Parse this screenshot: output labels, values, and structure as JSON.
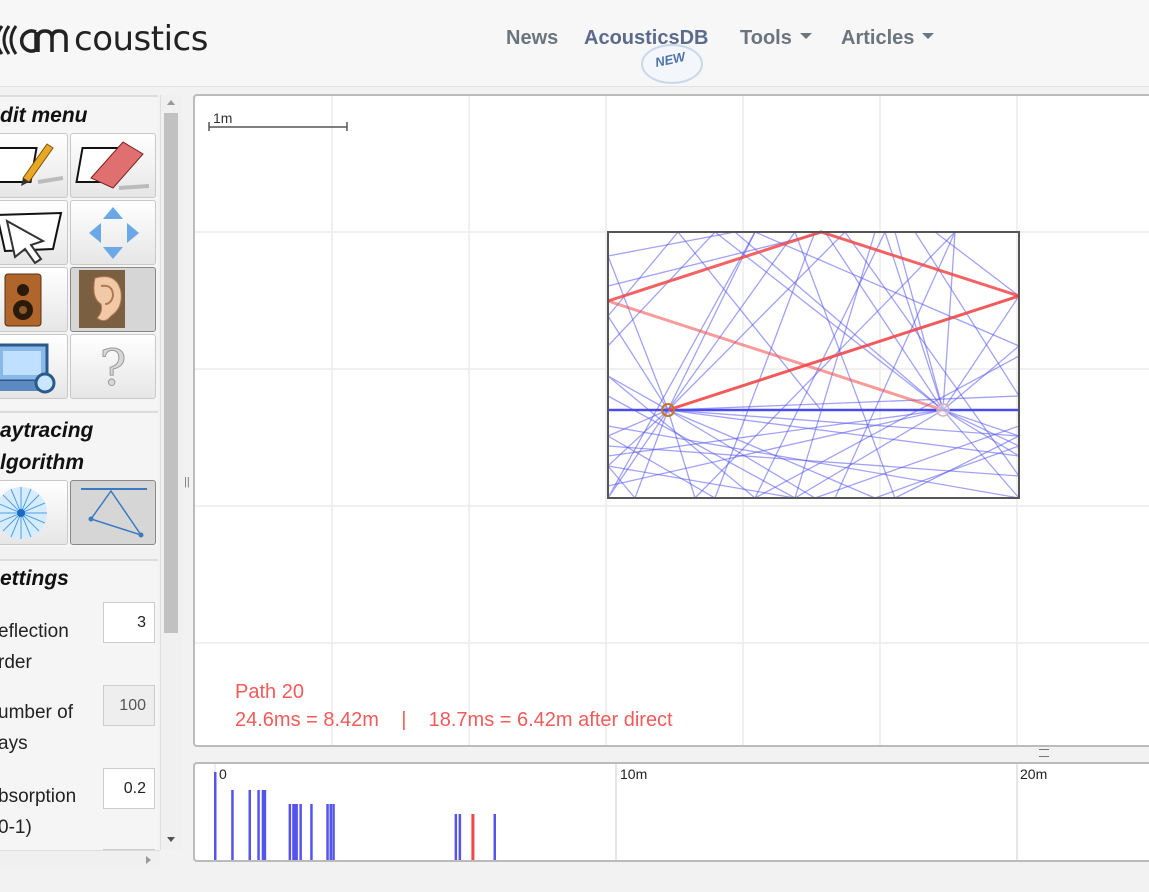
{
  "header": {
    "logo_text": "coustics",
    "nav": [
      {
        "label": "News"
      },
      {
        "label": "AcousticsDB",
        "badge": "NEW"
      },
      {
        "label": "Tools"
      },
      {
        "label": "Articles"
      }
    ]
  },
  "sidebar": {
    "edit_menu_title": "dit menu",
    "raytracing_title_1": "aytracing",
    "raytracing_title_2": "lgorithm",
    "settings_title": "ettings",
    "settings": [
      {
        "label_1": "eflection",
        "label_2": "rder",
        "value": "3",
        "disabled": false
      },
      {
        "label_1": "umber of",
        "label_2": "ays",
        "value": "100",
        "disabled": true
      },
      {
        "label_1": "bsorption",
        "label_2": "0-1)",
        "value": "0.2",
        "disabled": false
      }
    ],
    "tools": [
      {
        "icon": "pencil-draw-icon",
        "selected": false
      },
      {
        "icon": "eraser-icon",
        "selected": false
      },
      {
        "icon": "select-pointer-icon",
        "selected": false
      },
      {
        "icon": "move-arrows-icon",
        "selected": false
      },
      {
        "icon": "speaker-source-icon",
        "selected": false
      },
      {
        "icon": "ear-receiver-icon",
        "selected": true
      },
      {
        "icon": "screen-zoom-icon",
        "selected": false
      },
      {
        "icon": "help-icon",
        "selected": false
      }
    ],
    "algorithms": [
      {
        "icon": "raytracing-burst-icon",
        "selected": false
      },
      {
        "icon": "image-source-triangle-icon",
        "selected": true
      }
    ]
  },
  "canvas": {
    "scale_label": "1m",
    "path_title": "Path 20",
    "path_detail": "24.6ms = 8.42m    |    18.7ms = 6.42m after direct",
    "colors": {
      "ray": "#5555ee",
      "highlight": "#f04848",
      "room": "#555555"
    }
  },
  "echogram": {
    "tick_labels": [
      "0",
      "10m",
      "20m"
    ],
    "axis_max_m": 23.4,
    "reflections_m": [
      0.0,
      0.43,
      0.86,
      1.08,
      1.19,
      1.24,
      1.86,
      1.95,
      1.99,
      2.03,
      2.13,
      2.4,
      2.8,
      2.88,
      2.95,
      6.0,
      6.1,
      6.42,
      6.97
    ],
    "highlight_m": 6.42
  }
}
